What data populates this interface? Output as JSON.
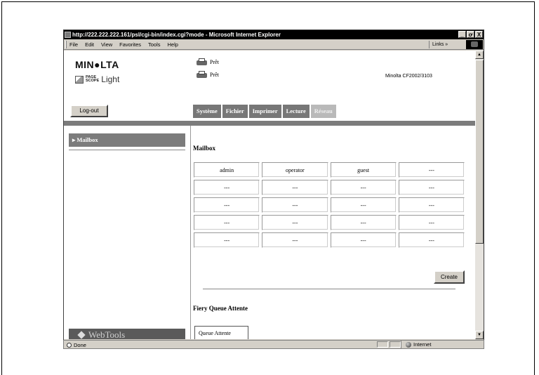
{
  "window": {
    "title": "http://222.222.222.161/psl/cgi-bin/index.cgi?mode - Microsoft Internet Explorer",
    "buttons": [
      "_",
      "ơ",
      "X"
    ]
  },
  "menubar": {
    "items": [
      "File",
      "Edit",
      "View",
      "Favorites",
      "Tools",
      "Help"
    ],
    "links_label": "Links »"
  },
  "header": {
    "brand": "MIN●LTA",
    "pagescope_small_top": "PAGE",
    "pagescope_small_bottom": "SCOPE",
    "pagescope_light": "Light",
    "status_lines": [
      "Prêt",
      "Prêt"
    ],
    "model": "Minolta CF2002/3103"
  },
  "logout_label": "Log-out",
  "tabs": [
    {
      "label": "Système",
      "active": false
    },
    {
      "label": "Fichier",
      "active": false
    },
    {
      "label": "Imprimer",
      "active": false
    },
    {
      "label": "Lecture",
      "active": false
    },
    {
      "label": "Réseau",
      "active": true
    }
  ],
  "sidebar": {
    "items": [
      {
        "label": "▸ Mailbox"
      }
    ],
    "footer_label": "WebTools"
  },
  "main": {
    "mailbox_title": "Mailbox",
    "mailbox_rows": [
      [
        "admin",
        "operator",
        "guest",
        "---"
      ],
      [
        "---",
        "---",
        "---",
        "---"
      ],
      [
        "---",
        "---",
        "---",
        "---"
      ],
      [
        "---",
        "---",
        "---",
        "---"
      ],
      [
        "---",
        "---",
        "---",
        "---"
      ]
    ],
    "create_label": "Create",
    "queue_title": "Fiery Queue Attente",
    "queue_button": "Queue Attente"
  },
  "scrollbar": {
    "up": "▲",
    "down": "▼"
  },
  "statusbar": {
    "done": "Done",
    "zone": "Internet"
  }
}
